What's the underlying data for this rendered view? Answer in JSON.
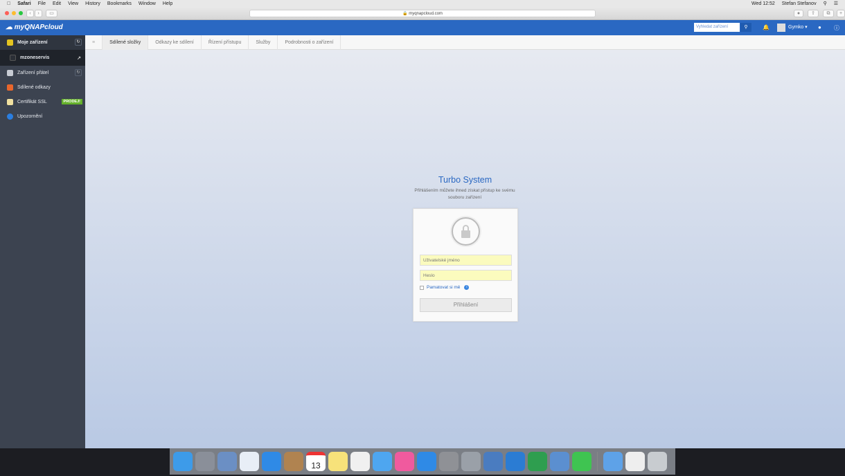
{
  "menubar": {
    "app": "Safari",
    "items": [
      "File",
      "Edit",
      "View",
      "History",
      "Bookmarks",
      "Window",
      "Help"
    ],
    "clock": "Wed 12:52",
    "user": "Stefan Stefanov"
  },
  "browser": {
    "url": "myqnapcloud.com"
  },
  "header": {
    "logo": "myQNAPcloud",
    "search_placeholder": "Vyhledat zařízení",
    "user": "Gymko"
  },
  "sidebar": {
    "items": [
      {
        "label": "Moje zařízení",
        "icon": "cube-icon",
        "color": "#e4c420"
      },
      {
        "label": "mzoneservis",
        "icon": "nas-icon",
        "color": "#2b2f36"
      },
      {
        "label": "Zařízení přátel",
        "icon": "friends-icon",
        "color": "#c8ccd4"
      },
      {
        "label": "Sdílené odkazy",
        "icon": "share-icon",
        "color": "#e8662c"
      },
      {
        "label": "Certifikát SSL",
        "icon": "certificate-icon",
        "color": "#f0e0a0",
        "badge": "PRODEJ!"
      },
      {
        "label": "Upozornění",
        "icon": "bell-icon",
        "color": "#2a7ee0"
      }
    ]
  },
  "tabs": [
    "Sdílené složky",
    "Odkazy ke sdílení",
    "Řízení přístupu",
    "Služby",
    "Podrobnosti o zařízení"
  ],
  "login": {
    "title": "Turbo System",
    "subtitle": "Přihlášením můžete ihned získat přístup ke svému souboru zařízení",
    "username_placeholder": "Uživatelské jméno",
    "password_placeholder": "Heslo",
    "remember": "Pamatovat si mě",
    "submit": "Přihlášení"
  },
  "dock": {
    "calendar_day": "13",
    "items": [
      {
        "name": "finder",
        "color": "#3d9be9"
      },
      {
        "name": "launchpad",
        "color": "#8a8f99"
      },
      {
        "name": "preview",
        "color": "#6b8fc4"
      },
      {
        "name": "mail",
        "color": "#e8eef6"
      },
      {
        "name": "safari",
        "color": "#2f8ae6"
      },
      {
        "name": "contacts",
        "color": "#b08350"
      },
      {
        "name": "calendar",
        "color": "#ffffff"
      },
      {
        "name": "notes",
        "color": "#f7e27a"
      },
      {
        "name": "photos",
        "color": "#f0f0f0"
      },
      {
        "name": "messages",
        "color": "#4ea6f0"
      },
      {
        "name": "itunes",
        "color": "#f05a9e"
      },
      {
        "name": "app-store",
        "color": "#2f8ae6"
      },
      {
        "name": "system-preferences",
        "color": "#8f9196"
      },
      {
        "name": "utility",
        "color": "#9aa0a8"
      },
      {
        "name": "network-utility",
        "color": "#4a7cc0"
      },
      {
        "name": "word",
        "color": "#2b7cd3"
      },
      {
        "name": "excel",
        "color": "#2e9e4f"
      },
      {
        "name": "remote-desktop",
        "color": "#5b8fd0"
      },
      {
        "name": "whatsapp",
        "color": "#3fc451"
      },
      {
        "name": "downloads",
        "color": "#5ea2e8"
      },
      {
        "name": "document",
        "color": "#eeeeee"
      },
      {
        "name": "trash",
        "color": "#c8ccd0"
      }
    ]
  }
}
